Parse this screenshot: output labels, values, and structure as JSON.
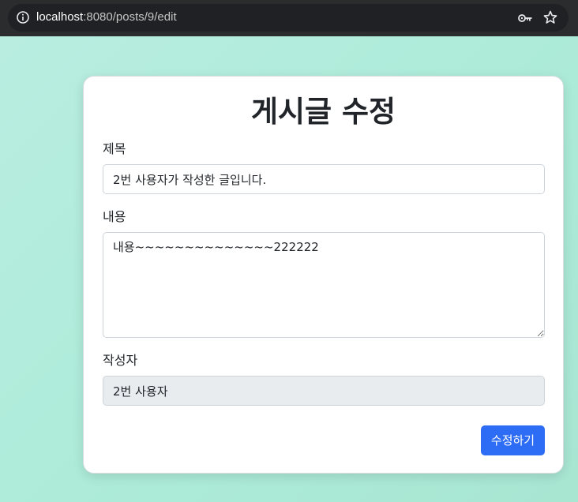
{
  "browser": {
    "url_host": "localhost",
    "url_path": ":8080/posts/9/edit"
  },
  "form": {
    "title": "게시글 수정",
    "subject_label": "제목",
    "subject_value": "2번 사용자가 작성한 글입니다.",
    "content_label": "내용",
    "content_value": "내용~~~~~~~~~~~~~~222222",
    "author_label": "작성자",
    "author_value": "2번 사용자",
    "submit_label": "수정하기"
  },
  "colors": {
    "primary": "#2d6df5",
    "background": "#b6ecdf"
  }
}
